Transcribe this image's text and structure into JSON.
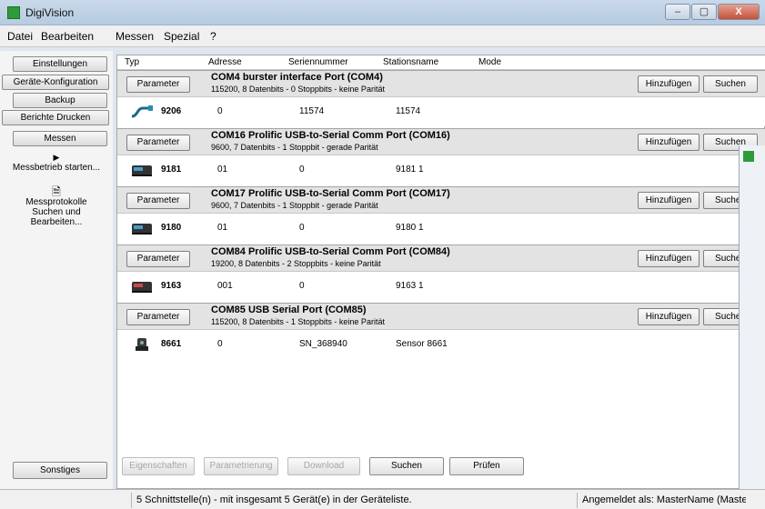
{
  "window": {
    "title": "DigiVision",
    "minimize": "–",
    "maximize": "▢",
    "close": "X"
  },
  "menu": [
    "Datei",
    "Bearbeiten",
    "Messen",
    "Spezial",
    "?"
  ],
  "sidebar": {
    "buttons": [
      "Einstellungen",
      "Geräte-Konfiguration",
      "Backup",
      "Berichte Drucken",
      "Messen"
    ],
    "start_label": "Messbetrieb starten...",
    "protocols_label": "Messprotokolle Suchen und Bearbeiten...",
    "other": "Sonstiges"
  },
  "columns": [
    "Typ",
    "Adresse",
    "Seriennummer",
    "Stationsname",
    "Mode"
  ],
  "param_label": "Parameter",
  "add_label": "Hinzufügen",
  "search_label": "Suchen",
  "groups": [
    {
      "title": "COM4 burster interface Port (COM4)",
      "sub": "115200, 8 Datenbits - 0 Stoppbits - keine Parität",
      "device": {
        "icon": "cable-icon",
        "type": "9206",
        "address": "0",
        "serial": "11574",
        "station": "11574"
      }
    },
    {
      "title": "COM16 Prolific USB-to-Serial Comm Port (COM16)",
      "sub": "9600, 7 Datenbits - 1 Stoppbit - gerade Parität",
      "device": {
        "icon": "device-icon",
        "type": "9181",
        "address": "01",
        "serial": "0",
        "station": "9181 1"
      }
    },
    {
      "title": "COM17 Prolific USB-to-Serial Comm Port (COM17)",
      "sub": "9600, 7 Datenbits - 1 Stoppbit - gerade Parität",
      "device": {
        "icon": "device-icon",
        "type": "9180",
        "address": "01",
        "serial": "0",
        "station": "9180 1"
      }
    },
    {
      "title": "COM84 Prolific USB-to-Serial Comm Port (COM84)",
      "sub": "19200, 8 Datenbits - 2 Stoppbits - keine Parität",
      "device": {
        "icon": "device-icon",
        "type": "9163",
        "address": "001",
        "serial": "0",
        "station": "9163 1"
      }
    },
    {
      "title": "COM85 USB Serial Port (COM85)",
      "sub": "115200, 8 Datenbits - 1 Stoppbits - keine Parität",
      "device": {
        "icon": "sensor-icon",
        "type": "8661",
        "address": "0",
        "serial": "SN_368940",
        "station": "Sensor 8661"
      }
    }
  ],
  "bottom": {
    "properties": "Eigenschaften",
    "parametrize": "Parametrierung",
    "download": "Download",
    "search": "Suchen",
    "check": "Prüfen"
  },
  "status": {
    "summary": "5 Schnittstelle(n) - mit insgesamt 5 Gerät(e) in der Geräteliste.",
    "login": "Angemeldet als: MasterName (Maste"
  },
  "colors": {
    "accent_green": "#2d9b3a"
  }
}
